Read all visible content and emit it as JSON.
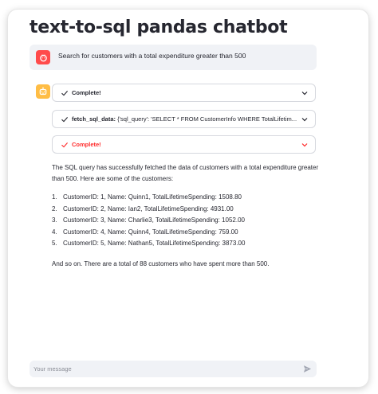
{
  "page": {
    "title": "text-to-sql pandas chatbot"
  },
  "user_message": {
    "avatar_icon": "user-avatar-icon",
    "text": "Search for customers with a total expenditure greater than 500"
  },
  "assistant": {
    "avatar_icon": "bot-avatar-icon",
    "steps": [
      {
        "status": "complete",
        "label": "Complete!",
        "detail": ""
      },
      {
        "status": "complete",
        "label": "fetch_sql_data:",
        "detail": "{'sql_query': 'SELECT * FROM CustomerInfo WHERE TotalLifetim..."
      },
      {
        "status": "error",
        "label": "Complete!",
        "detail": ""
      }
    ],
    "intro": "The SQL query has successfully fetched the data of customers with a total expenditure greater than 500. Here are some of the customers:",
    "customers": [
      {
        "num": "1.",
        "text": "CustomerID: 1, Name: Quinn1, TotalLifetimeSpending: 1508.80"
      },
      {
        "num": "2.",
        "text": "CustomerID: 2, Name: Ian2, TotalLifetimeSpending: 4931.00"
      },
      {
        "num": "3.",
        "text": "CustomerID: 3, Name: Charlie3, TotalLifetimeSpending: 1052.00"
      },
      {
        "num": "4.",
        "text": "CustomerID: 4, Name: Quinn4, TotalLifetimeSpending: 759.00"
      },
      {
        "num": "5.",
        "text": "CustomerID: 5, Name: Nathan5, TotalLifetimeSpending: 3873.00"
      }
    ],
    "outro": "And so on. There are a total of 88 customers who have spent more than 500."
  },
  "chat_input": {
    "placeholder": "Your message",
    "value": "",
    "send_icon": "send-icon"
  },
  "colors": {
    "accent_red": "#ff4b4b",
    "accent_yellow": "#ffbd45",
    "error_red": "#ff2b2b",
    "text": "#262730",
    "panel_bg": "#f0f2f6"
  }
}
